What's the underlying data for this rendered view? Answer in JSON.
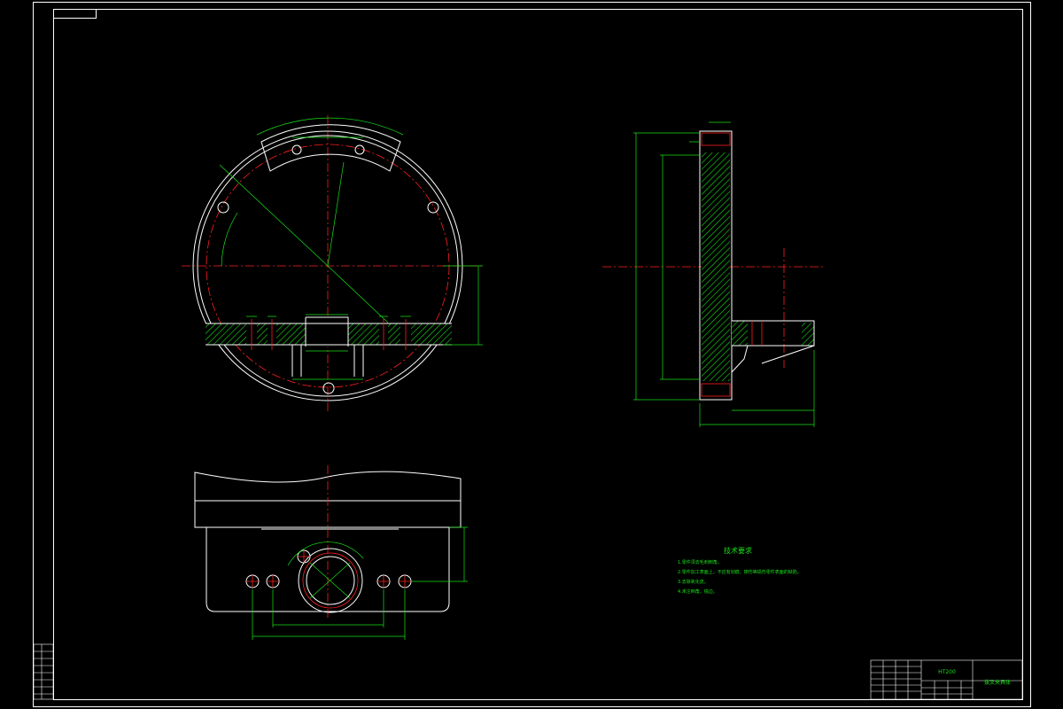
{
  "tech_requirements": {
    "title": "技术要求",
    "items": [
      "1.零件须去毛刺倒角。",
      "2.零件加工表面上，不应有划痕、擦伤等损伤零件表面的缺陷。",
      "3.去除氧化皮。",
      "4.未注倒角，锐边。"
    ]
  },
  "title_block": {
    "drawing_name": "拨叉夹具体",
    "material": "HT200"
  },
  "colors": {
    "background": "#000000",
    "outline": "#ffffff",
    "centerline": "#ff2020",
    "dimension": "#19e119"
  }
}
